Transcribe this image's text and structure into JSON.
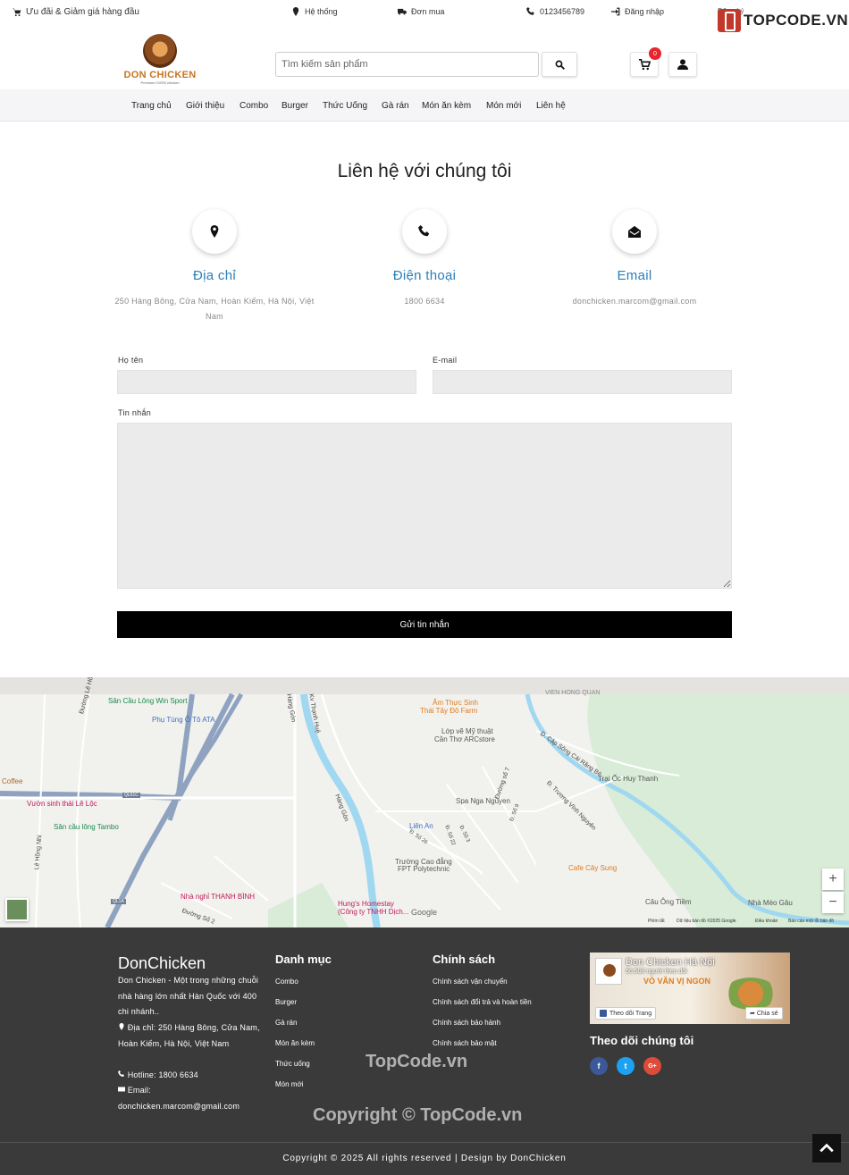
{
  "topbar": {
    "promo": "Ưu đãi & Giảm giá hàng đầu",
    "system": "Hệ thống",
    "orders": "Đơn mua",
    "phone": "0123456789",
    "login": "Đăng nhập",
    "signup": "Đăng ký",
    "watermark_logo": "TOPCODE.VN"
  },
  "header": {
    "brand_name": "DON CHICKEN",
    "brand_tagline": "Premium OVEN chicken",
    "search_placeholder": "Tìm kiếm sản phẩm",
    "cart_count": "0"
  },
  "nav": {
    "items": [
      "Trang chủ",
      "Giới thiệu",
      "Combo",
      "Burger",
      "Thức Uống",
      "Gà rán",
      "Món ăn kèm",
      "Món mới",
      "Liên hệ"
    ]
  },
  "contact": {
    "title": "Liên hệ với chúng tôi",
    "address_title": "Địa chỉ",
    "address_text": "250 Hàng Bông, Cửa Nam, Hoàn Kiếm, Hà Nội, Việt Nam",
    "phone_title": "Điện thoại",
    "phone_text": "1800 6634",
    "email_title": "Email",
    "email_text": "donchicken.marcom@gmail.com",
    "name_label": "Họ tên",
    "email_label": "E-mail",
    "message_label": "Tin nhắn",
    "submit_label": "Gửi tin nhắn"
  },
  "map": {
    "labels": {
      "l1": "Sân Cầu Lông Win Sport",
      "l2": "Phụ Tùng Ô Tô ATA",
      "l3": "Coffee",
      "l4": "Vườn sinh thái Lê Lộc",
      "l5": "Sân cầu lông Tambo",
      "l6": "Nhà nghỉ THANH BÌNH",
      "l7": "Hung's Homestay",
      "l8": "(Công ty TNHH Dịch...",
      "l9": "Ẩm Thực Sinh",
      "l10": "Thái Tây Đô Farm",
      "l11": "Lớp vẽ Mỹ thuật",
      "l12": "Cần Thơ ARCstore",
      "l13": "Spa Nga Nguyen",
      "l14": "Liên An",
      "l15": "Trường Cao đẳng",
      "l16": "FPT Polytechnic",
      "l17": "Trại Ốc Huy Thanh",
      "l18": "Cafe Cây Sung",
      "l19": "Câu Ông Tiềm",
      "l20": "Nhà Mèo Gâu",
      "l21": "VIEN HONG QUAN",
      "r1": "Đường Lê Hồng Nhi",
      "r2": "Lê Hồng Nhi",
      "r3": "Hàng Gòn",
      "r4": "Kv Thạnh Huệ",
      "r5": "Đ. Trương Vĩnh Nguyên",
      "r6": "Đ. Cặp Sông Cái Răng Bé",
      "r7": "Đường số 7",
      "r8": "QL61C",
      "r9": "QL1A",
      "r10": "Đường Số 2",
      "r11": "Đ. Số 26",
      "r12": "Đ. Số 22",
      "r13": "Đ. Số 9",
      "r14": "Đ. Số 3",
      "r15": "Hàng Gòn",
      "google": "Google",
      "foot1": "Phím tắt",
      "foot2": "Dữ liệu bản đồ ©2025 Google",
      "foot3": "Điều khoản",
      "foot4": "Báo cáo một lỗi bản đồ",
      "zoom_in": "+",
      "zoom_out": "−"
    }
  },
  "footer": {
    "brand_title": "DonChicken",
    "desc": "Don Chicken - Một trong những chuỗi nhà hàng lớn nhất Hàn Quốc với 400 chi nhánh..",
    "address": "Địa chỉ: 250 Hàng Bông, Cửa Nam, Hoàn Kiếm, Hà Nội, Việt Nam",
    "hotline": "Hotline: 1800 6634",
    "email": "Email: donchicken.marcom@gmail.com",
    "categories_title": "Danh mục",
    "categories": [
      "Combo",
      "Burger",
      "Gà rán",
      "Món ăn kèm",
      "Thức uống",
      "Món mới"
    ],
    "policy_title": "Chính sách",
    "policies": [
      "Chính sách vận chuyển",
      "Chính sách đổi trả và hoàn tiền",
      "Chính sách bảo hành",
      "Chính sách bảo mật"
    ],
    "fb_page_name": "Don Chicken Hà Nội",
    "fb_followers": "56.508 người theo dõi",
    "fb_banner": "VÒ VĂN VỊ NGON",
    "fb_follow": "Theo dõi Trang",
    "fb_share": "Chia sẻ",
    "follow_title": "Theo dõi chúng tôi",
    "social": [
      "f",
      "t",
      "G+"
    ],
    "watermark1": "TopCode.vn",
    "watermark2": "Copyright © TopCode.vn",
    "copyright": "Copyright © 2025 All rights reserved | Design by DonChicken"
  },
  "colors": {
    "accent_blue": "#2a7fb8",
    "brand_orange": "#c9731f",
    "badge_red": "#e8252d",
    "footer_bg": "#3a3a3a",
    "facebook": "#3b5998",
    "twitter": "#1da1f2",
    "google_plus": "#dd4b39"
  }
}
